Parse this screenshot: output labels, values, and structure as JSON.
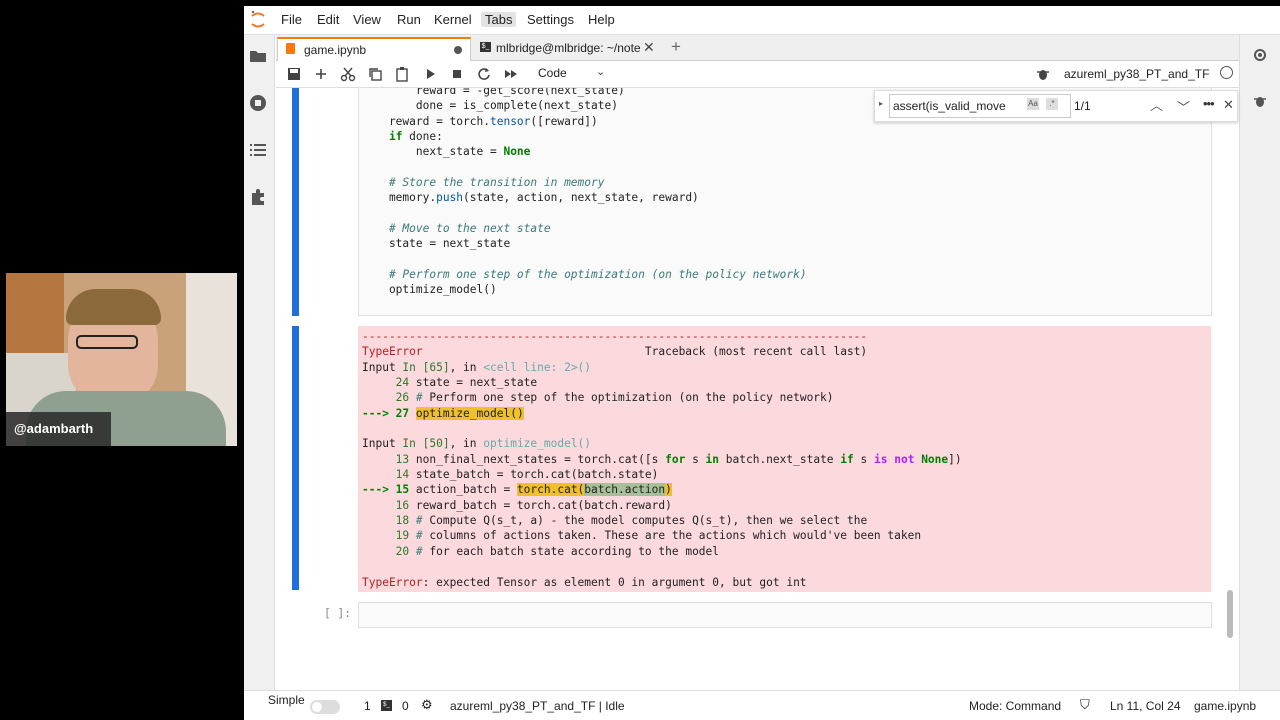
{
  "menubar": {
    "items": [
      "File",
      "Edit",
      "View",
      "Run",
      "Kernel",
      "Tabs",
      "Settings",
      "Help"
    ]
  },
  "tabs": [
    {
      "label": "game.ipynb"
    },
    {
      "label": "mlbridge@mlbridge: ~/note"
    }
  ],
  "toolbar": {
    "cell_type": "Code",
    "kernel_name": "azureml_py38_PT_and_TF"
  },
  "find": {
    "value": "assert(is_valid_move",
    "count": "1/1"
  },
  "cells": {
    "empty_prompt": "[ ]:"
  },
  "webcam": {
    "handle": "@adambarth"
  },
  "status": {
    "mode_label": "Simple",
    "cells_count": "1",
    "terminals_count": "0",
    "kernel_status": "azureml_py38_PT_and_TF | Idle",
    "mode": "Mode: Command",
    "position": "Ln 11, Col 24",
    "filename": "game.ipynb"
  },
  "colors": {
    "accent": "#f57c00",
    "error_bg": "#fbd9dd",
    "active_cell_bar": "#1e6fd9"
  }
}
